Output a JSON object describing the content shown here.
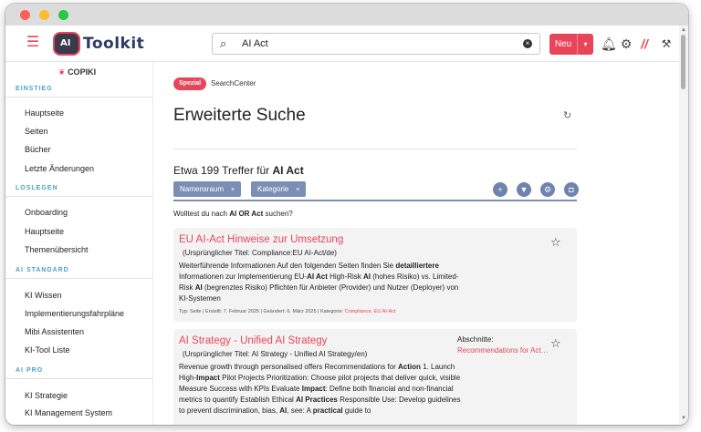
{
  "window": {
    "traffic_lights": [
      "#ff5f57",
      "#febc2e",
      "#28c840"
    ]
  },
  "topnav": {
    "menu_icon": "hamburger-icon",
    "logo_mark": "AI",
    "logo_text": "Toolkit",
    "search": {
      "value": "AI Act",
      "placeholder": "",
      "icon": "search-icon"
    },
    "new_button": "Neu",
    "icons": [
      "bell-icon",
      "gear-icon",
      "pen-icon",
      "tool-icon"
    ]
  },
  "sidebar": {
    "brand": "COPIKI",
    "sections": [
      {
        "title": "EINSTIEG",
        "items": [
          "Hauptseite",
          "Seiten",
          "Bücher",
          "Letzte Änderungen"
        ]
      },
      {
        "title": "LOSLEGEN",
        "items": [
          "Onboarding",
          "Hauptseite",
          "Themenübersicht"
        ]
      },
      {
        "title": "AI STANDARD",
        "items": [
          "KI Wissen",
          "Implementierungsfahrpläne",
          "Mibi Assistenten",
          "KI-Tool Liste"
        ]
      },
      {
        "title": "AI PRO",
        "items": [
          "KI Strategie",
          "KI Management System"
        ]
      }
    ]
  },
  "main": {
    "special_tag": "Spezial",
    "special_label": "SearchCenter",
    "heading": "Erweiterte Suche",
    "result_count_prefix": "Etwa 199 Treffer für ",
    "result_count_query": "AI Act",
    "filters": [
      {
        "label": "Namensraum",
        "remove": "×"
      },
      {
        "label": "Kategorie",
        "remove": "×"
      }
    ],
    "filter_icons": [
      "plus-icon",
      "funnel-icon",
      "gear-icon",
      "camera-icon"
    ],
    "suggestion": {
      "prefix": "Wolltest du nach ",
      "query": "AI OR Act",
      "suffix": " suchen?"
    },
    "results": [
      {
        "title": "EU AI-Act Hinweise zur Umsetzung",
        "original_title": "(Ursprünglicher Titel: Compliance:EU AI-Act/de)",
        "snippet": [
          {
            "t": "Weiterführende Informationen Auf den folgenden Seiten finden Sie "
          },
          {
            "t": "detailliertere",
            "b": true
          },
          {
            "t": " Informationen zur Implementierung EU-"
          },
          {
            "t": "AI Act",
            "b": true
          },
          {
            "t": " High-Risk "
          },
          {
            "t": "AI",
            "b": true
          },
          {
            "t": " (hohes Risiko) vs. Limited-Risk "
          },
          {
            "t": "AI",
            "b": true
          },
          {
            "t": " (begrenztes Risiko) Pflichten für Anbieter (Provider) und Nutzer (Deployer) von KI-Systemen"
          }
        ],
        "meta": "Typ: Seite  |  Erstellt: 7. Februar 2025  |  Geändert: 6. März 2025  |  Kategorie: ",
        "categories": "Compliance, EU AI-Act"
      },
      {
        "title": "AI Strategy - Unified AI Strategy",
        "original_title": "(Ursprünglicher Titel: AI Strategy - Unified AI Strategy/en)",
        "sections_label": "Abschnitte:",
        "sections_value": "Recommendations for Action",
        "snippet": [
          {
            "t": "Revenue growth through personalised offers Recommendations for "
          },
          {
            "t": "Action",
            "b": true
          },
          {
            "t": " 1. Launch High-"
          },
          {
            "t": "Impact",
            "b": true
          },
          {
            "t": " Pilot Projects Prioritization: Choose pilot projects that deliver quick, visible Measure Success with KPIs Evaluate "
          },
          {
            "t": "Impact",
            "b": true
          },
          {
            "t": ": Define both financial and non-financial metrics to quantify Establish Ethical "
          },
          {
            "t": "AI Practices",
            "b": true
          },
          {
            "t": " Responsible Use: Develop guidelines to prevent discrimination, bias, "
          },
          {
            "t": "AI",
            "b": true
          },
          {
            "t": ", see: A "
          },
          {
            "t": "practical",
            "b": true
          },
          {
            "t": " guide to"
          }
        ]
      }
    ]
  }
}
